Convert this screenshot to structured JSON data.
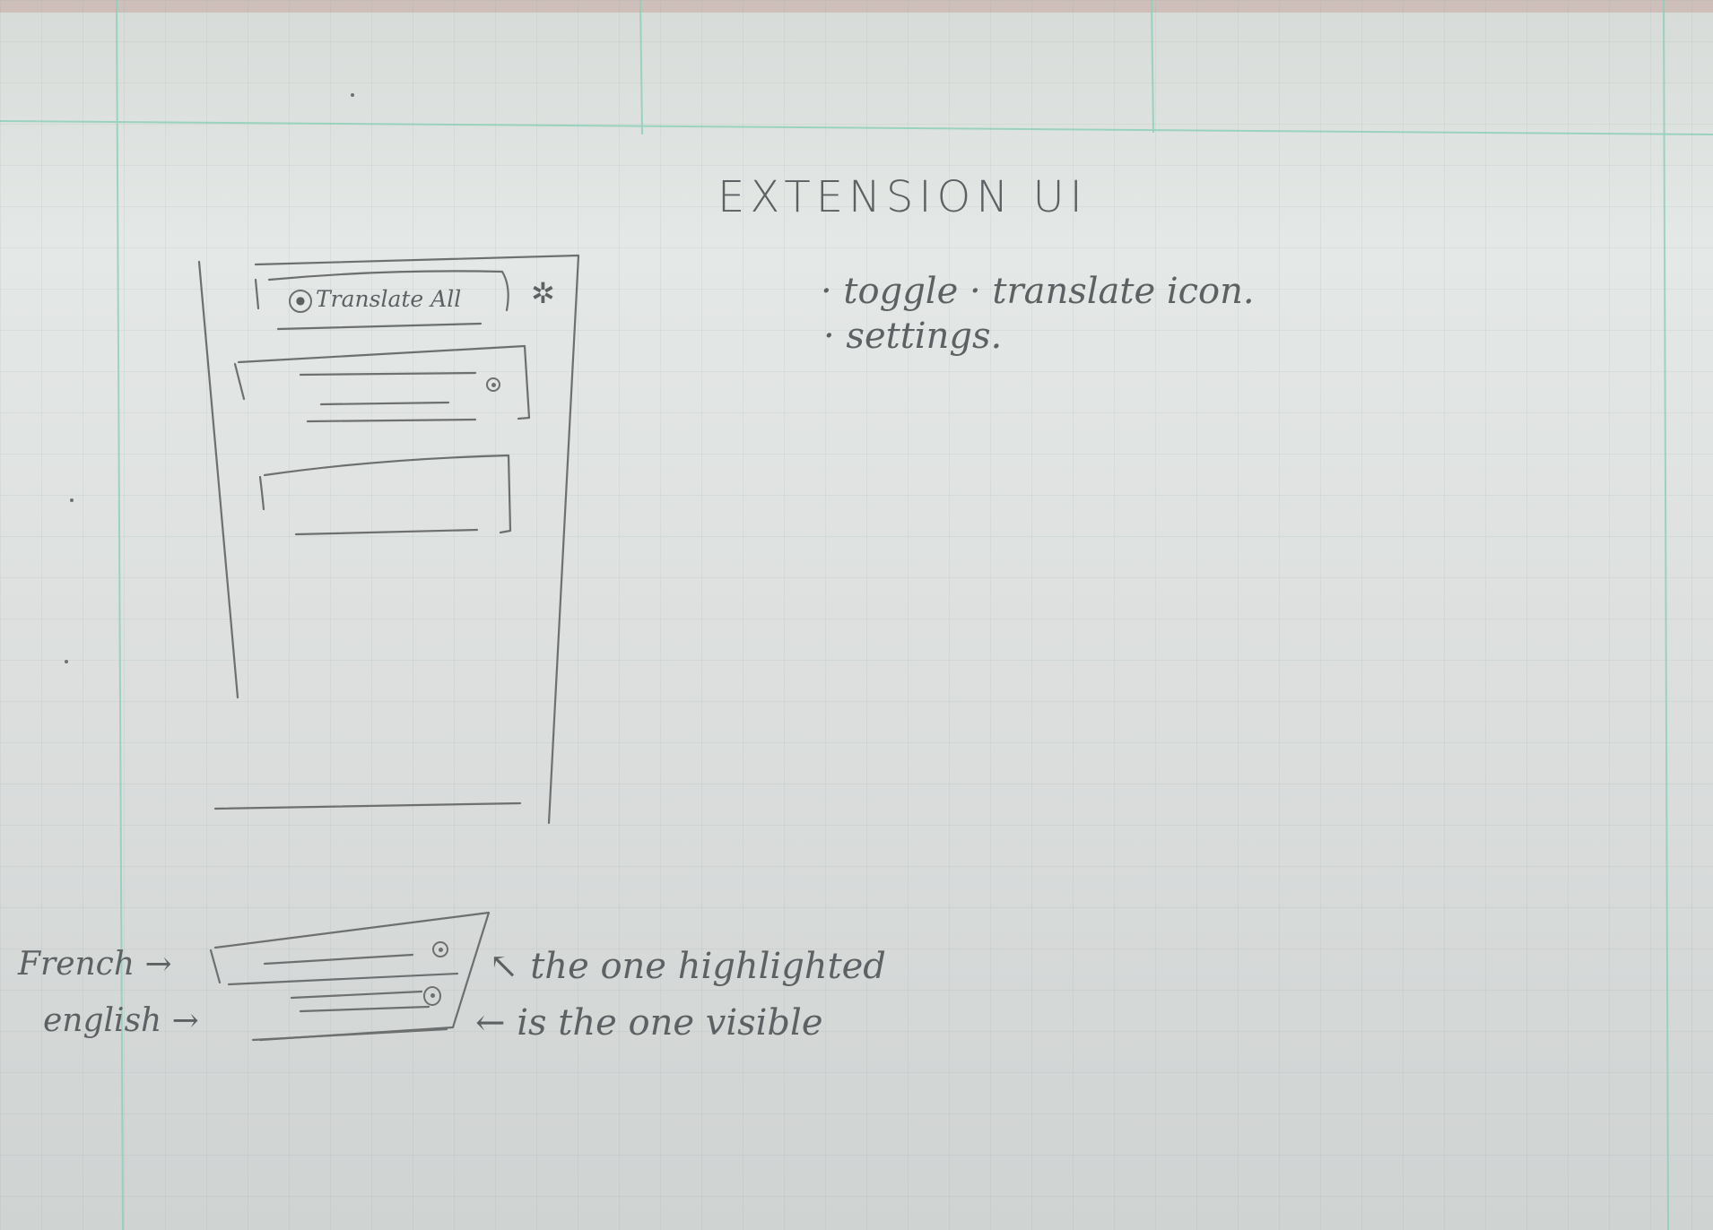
{
  "title": "EXTENSION UI",
  "popup": {
    "translate_all_label": "Translate All",
    "settings_icon": "gear-icon",
    "toggle_icon": "eye-icon"
  },
  "notes": {
    "line1": "· toggle · translate icon.",
    "line2": "· settings."
  },
  "bottom": {
    "french_label": "French →",
    "english_label": "english →",
    "note_highlighted": "the one highlighted",
    "note_visible": "is the one visible"
  },
  "colors": {
    "ink": "#6d6f70",
    "grid_line": "#8fd0bb",
    "paper": "#dfe3e1"
  }
}
